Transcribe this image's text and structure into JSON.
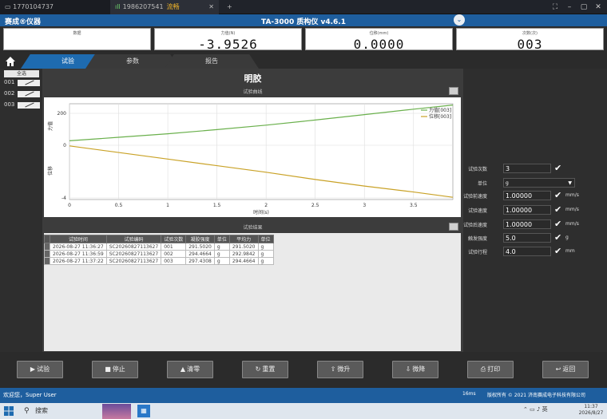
{
  "remote": {
    "tab1_label": "1770104737",
    "tab2_label": "1986207541",
    "tab2_badge": "流畅",
    "add_label": "+"
  },
  "app": {
    "logo": "赛成®仪器",
    "title": "TA-3000 质构仪    v4.6.1"
  },
  "readouts": [
    {
      "label": "数据",
      "value": ""
    },
    {
      "label": "力值(N)",
      "value": "-3.9526"
    },
    {
      "label": "位移(mm)",
      "value": "0.0000"
    },
    {
      "label": "次数(次)",
      "value": "003"
    }
  ],
  "nav": {
    "tabs": [
      "试验",
      "参数",
      "报告"
    ],
    "active_tab": "试验"
  },
  "samples": {
    "select_all": "全选",
    "items": [
      "001",
      "002",
      "003"
    ]
  },
  "main": {
    "title": "明胶",
    "curve_title": "试验曲线",
    "results_title": "试验结果"
  },
  "chart_data": {
    "type": "line",
    "xlabel": "时间(s)",
    "ylabel_left_top": "力值",
    "ylabel_left_bottom": "位移",
    "x_ticks": [
      "0",
      "0.5",
      "1",
      "1.5",
      "2",
      "2.5",
      "3",
      "3.5"
    ],
    "y_ticks": [
      "200",
      "0",
      "-4"
    ],
    "xlim": [
      0,
      3.9
    ],
    "series": [
      {
        "name": "力值[003]",
        "color": "#6ab04c",
        "x": [
          0,
          0.5,
          1,
          1.5,
          2,
          2.5,
          3,
          3.5,
          3.9
        ],
        "y": [
          28,
          50,
          72,
          98,
          126,
          158,
          192,
          226,
          252
        ]
      },
      {
        "name": "位移[003]",
        "color": "#c9a227",
        "x": [
          0,
          0.5,
          1,
          1.5,
          2,
          2.5,
          3,
          3.5,
          3.9
        ],
        "y": [
          -0.05,
          -0.55,
          -1.05,
          -1.55,
          -2.05,
          -2.6,
          -3.1,
          -3.55,
          -3.95
        ]
      }
    ],
    "legend_position": "top-right"
  },
  "results": {
    "columns": [
      "试验时间",
      "试验编码",
      "试验次数",
      "凝胶强度",
      "单位",
      "平均力",
      "单位"
    ],
    "rows": [
      [
        "2026-08-27 11:36:27",
        "SC20260827113627",
        "001",
        "291.5020",
        "g",
        "291.5020",
        "g"
      ],
      [
        "2026-08-27 11:36:59",
        "SC20260827113627",
        "002",
        "294.4664",
        "g",
        "292.9842",
        "g"
      ],
      [
        "2026-08-27 11:37:22",
        "SC20260827113627",
        "003",
        "297.4308",
        "g",
        "294.4664",
        "g"
      ]
    ]
  },
  "params": [
    {
      "label": "试验次数",
      "value": "3",
      "unit": "",
      "type": "input"
    },
    {
      "label": "单位",
      "value": "g",
      "unit": "",
      "type": "select"
    },
    {
      "label": "试验前速度",
      "value": "1.00000",
      "unit": "mm/s",
      "type": "input"
    },
    {
      "label": "试验速度",
      "value": "1.00000",
      "unit": "mm/s",
      "type": "input"
    },
    {
      "label": "试验后速度",
      "value": "1.00000",
      "unit": "mm/s",
      "type": "input"
    },
    {
      "label": "触发强度",
      "value": "5.0",
      "unit": "g",
      "type": "input"
    },
    {
      "label": "试验行程",
      "value": "4.0",
      "unit": "mm",
      "type": "input"
    }
  ],
  "buttons": [
    {
      "label": "试验",
      "icon": "play-icon"
    },
    {
      "label": "停止",
      "icon": "stop-icon"
    },
    {
      "label": "清零",
      "icon": "triangle-icon"
    },
    {
      "label": "重置",
      "icon": "reset-icon"
    },
    {
      "label": "微升",
      "icon": "upload-icon"
    },
    {
      "label": "微降",
      "icon": "download-icon"
    },
    {
      "label": "打印",
      "icon": "printer-icon"
    },
    {
      "label": "返回",
      "icon": "back-icon"
    }
  ],
  "status": {
    "welcome": "欢迎您，Super User",
    "latency": "16ms",
    "copyright": "版权所有 © 2021 济南赛成电子科技有限公司"
  },
  "taskbar": {
    "search": "搜索",
    "ime": "英",
    "time": "11:37",
    "date": "2026/8/27"
  }
}
